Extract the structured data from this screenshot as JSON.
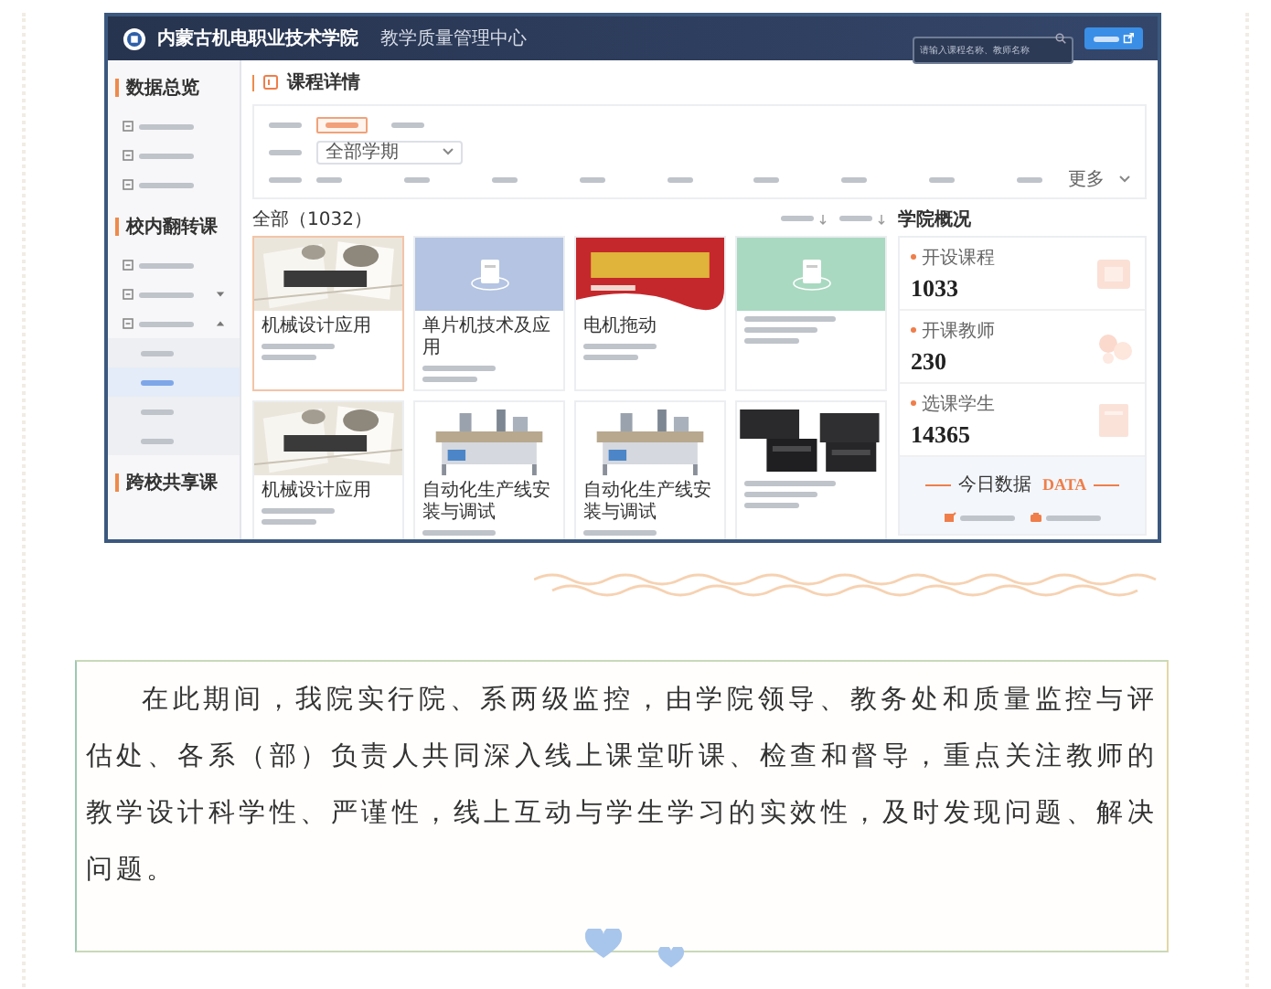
{
  "header": {
    "title": "内蒙古机电职业技术学院",
    "subtitle": "教学质量管理中心",
    "search": {
      "placeholder": "请输入课程名称、教师名称"
    }
  },
  "sidebar": {
    "sections": [
      {
        "heading": "数据总览",
        "items": [
          {
            "selected": false
          },
          {
            "selected": false
          },
          {
            "selected": false
          }
        ]
      },
      {
        "heading": "校内翻转课",
        "items": [
          {
            "selected": false
          },
          {
            "selected": false,
            "expanded": false
          },
          {
            "selected": false,
            "expanded": true,
            "children": [
              {
                "selected": false
              },
              {
                "selected": true
              },
              {
                "selected": false
              },
              {
                "selected": false
              }
            ]
          }
        ]
      },
      {
        "heading": "跨校共享课"
      }
    ]
  },
  "page_title": "课程详情",
  "filters": {
    "type_chips": [
      {
        "selected": true
      },
      {
        "selected": false
      }
    ],
    "term_select": {
      "value": "全部学期"
    },
    "categories": [
      {
        "selected": false
      },
      {
        "selected": false
      },
      {
        "selected": false
      },
      {
        "selected": false
      },
      {
        "selected": false
      },
      {
        "selected": false
      },
      {
        "selected": false
      },
      {
        "selected": false
      },
      {
        "selected": false
      }
    ],
    "more": "更多"
  },
  "course_count": "全部（1032）",
  "sort_options": [
    {
      "selected": false
    },
    {
      "selected": false
    }
  ],
  "courses": [
    {
      "title": "机械设计应用",
      "selected": true
    },
    {
      "title": "单片机技术及应用",
      "selected": false,
      "cover": {
        "kind": "placeholder",
        "color": "#b4c4e2"
      }
    },
    {
      "title": "电机拖动",
      "selected": false
    },
    {
      "selected": false,
      "cover": {
        "kind": "placeholder",
        "color": "#a9d9c0"
      }
    },
    {
      "title": "机械设计应用",
      "selected": false
    },
    {
      "title": "自动化生产线安装与调试",
      "selected": false
    },
    {
      "title": "自动化生产线安装与调试",
      "selected": false
    },
    {
      "selected": false
    }
  ],
  "overview": {
    "title": "学院概况",
    "stats": [
      {
        "label": "开设课程",
        "value": "1033"
      },
      {
        "label": "开课教师",
        "value": "230"
      },
      {
        "label": "选课学生",
        "value": "14365"
      }
    ],
    "today": {
      "title": "今日数据",
      "accent": "DATA",
      "entries": [
        {
          "kind": "visits"
        },
        {
          "kind": "resources"
        }
      ]
    }
  },
  "article": {
    "paragraph": "在此期间，我院实行院、系两级监控，由学院领导、教务处和质量监控与评估处、各系（部）负责人共同深入线上课堂听课、检查和督导，重点关注教师的教学设计科学性、严谨性，线上互动与学生学习的实效性，及时发现问题、解决问题。"
  }
}
